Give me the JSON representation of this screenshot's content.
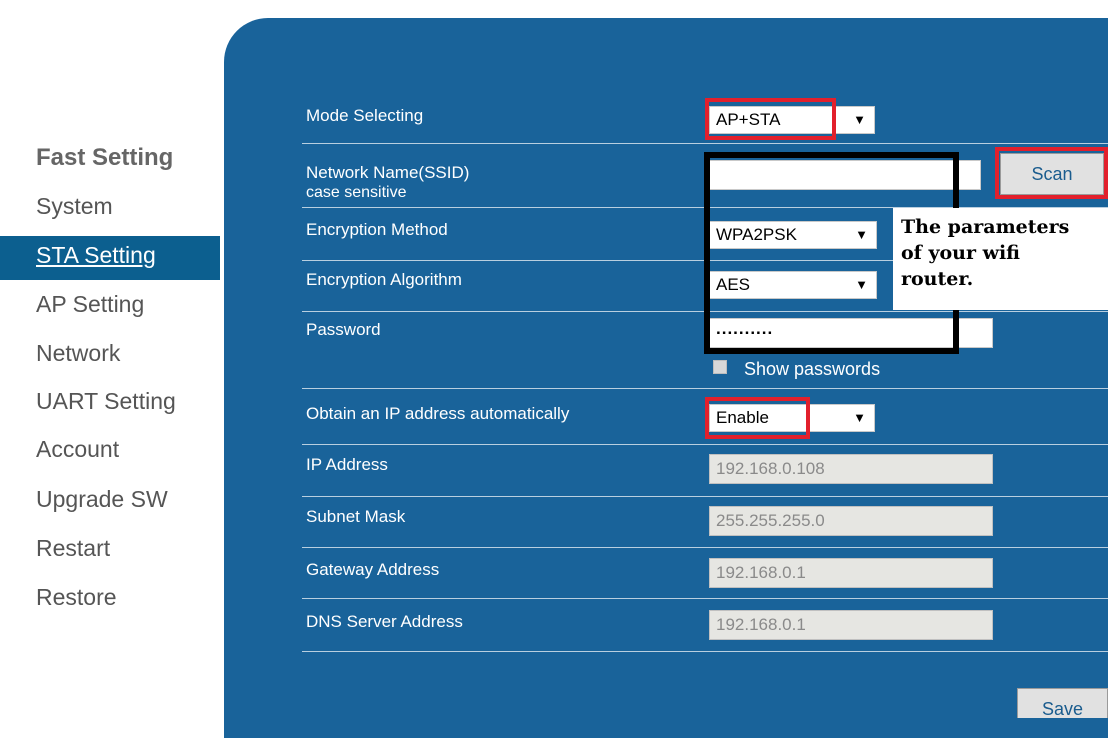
{
  "sidebar": {
    "title": "Fast Setting",
    "items": [
      {
        "label": "System"
      },
      {
        "label": "STA Setting"
      },
      {
        "label": "AP Setting"
      },
      {
        "label": "Network"
      },
      {
        "label": "UART Setting"
      },
      {
        "label": "Account"
      },
      {
        "label": "Upgrade SW"
      },
      {
        "label": "Restart"
      },
      {
        "label": "Restore"
      }
    ],
    "active_item": "STA Setting"
  },
  "form": {
    "mode": {
      "label": "Mode Selecting",
      "value": "AP+STA"
    },
    "ssid": {
      "label": "Network Name(SSID)",
      "sublabel": "case sensitive",
      "value": "",
      "scan_label": "Scan"
    },
    "encryption_method": {
      "label": "Encryption Method",
      "value": "WPA2PSK"
    },
    "encryption_algorithm": {
      "label": "Encryption Algorithm",
      "value": "AES"
    },
    "password": {
      "label": "Password",
      "value": "..........",
      "show_label": "Show passwords"
    },
    "dhcp": {
      "label": "Obtain an IP address automatically",
      "value": "Enable"
    },
    "ip": {
      "label": "IP Address",
      "value": "192.168.0.108"
    },
    "subnet": {
      "label": "Subnet Mask",
      "value": "255.255.255.0"
    },
    "gateway": {
      "label": "Gateway Address",
      "value": "192.168.0.1"
    },
    "dns": {
      "label": "DNS Server Address",
      "value": "192.168.0.1"
    },
    "save_label": "Save"
  },
  "annotation": {
    "lines": [
      "The parameters",
      "of your wifi",
      "router."
    ]
  },
  "colors": {
    "panel": "#19639a",
    "highlight_red": "#e2202c",
    "highlight_black": "#000000",
    "sidebar_active": "#0c5f8f"
  },
  "icons": {
    "dropdown_arrow": "▼"
  }
}
